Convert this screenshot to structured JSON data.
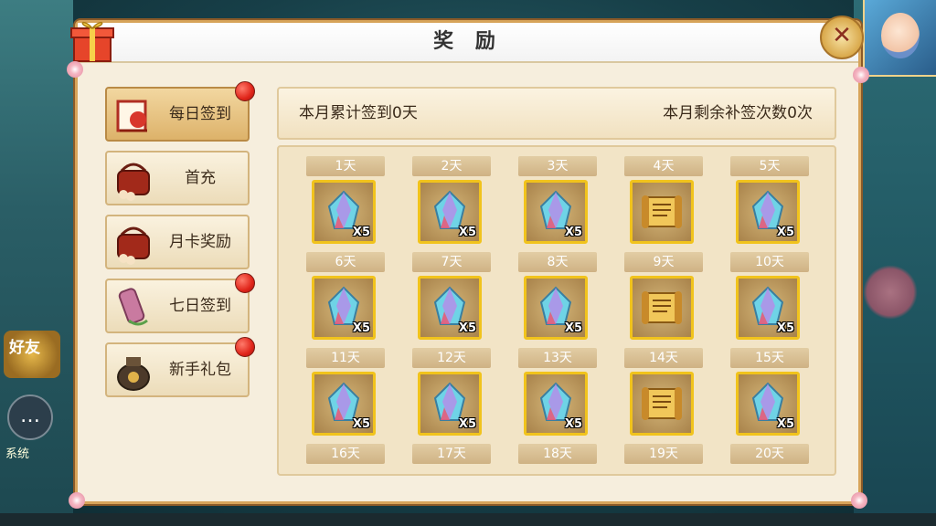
{
  "dialog": {
    "title": "奖 励",
    "close_icon": "close-icon",
    "gift_icon": "gift-box-icon"
  },
  "menu": [
    {
      "label": "每日签到",
      "icon": "sign-in-scroll-icon",
      "active": true,
      "badge": true
    },
    {
      "label": "首充",
      "icon": "basket-icon",
      "active": false,
      "badge": false
    },
    {
      "label": "月卡奖励",
      "icon": "basket-icon",
      "active": false,
      "badge": false
    },
    {
      "label": "七日签到",
      "icon": "scroll-icon",
      "active": false,
      "badge": true
    },
    {
      "label": "新手礼包",
      "icon": "treasure-jar-icon",
      "active": false,
      "badge": true
    }
  ],
  "info": {
    "total_signed": "本月累计签到0天",
    "remaining_makeup": "本月剩余补签次数0次"
  },
  "rewards": [
    {
      "day": "1天",
      "item": "crystal-icon",
      "qty": "X5"
    },
    {
      "day": "2天",
      "item": "crystal-icon",
      "qty": "X5"
    },
    {
      "day": "3天",
      "item": "crystal-icon",
      "qty": "X5"
    },
    {
      "day": "4天",
      "item": "scroll-icon",
      "qty": ""
    },
    {
      "day": "5天",
      "item": "crystal-icon",
      "qty": "X5"
    },
    {
      "day": "6天",
      "item": "crystal-icon",
      "qty": "X5"
    },
    {
      "day": "7天",
      "item": "crystal-icon",
      "qty": "X5"
    },
    {
      "day": "8天",
      "item": "crystal-icon",
      "qty": "X5"
    },
    {
      "day": "9天",
      "item": "scroll-icon",
      "qty": ""
    },
    {
      "day": "10天",
      "item": "crystal-icon",
      "qty": "X5"
    },
    {
      "day": "11天",
      "item": "crystal-icon",
      "qty": "X5"
    },
    {
      "day": "12天",
      "item": "crystal-icon",
      "qty": "X5"
    },
    {
      "day": "13天",
      "item": "crystal-icon",
      "qty": "X5"
    },
    {
      "day": "14天",
      "item": "scroll-icon",
      "qty": ""
    },
    {
      "day": "15天",
      "item": "crystal-icon",
      "qty": "X5"
    },
    {
      "day": "16天",
      "item": "",
      "qty": ""
    },
    {
      "day": "17天",
      "item": "",
      "qty": ""
    },
    {
      "day": "18天",
      "item": "",
      "qty": ""
    },
    {
      "day": "19天",
      "item": "",
      "qty": ""
    },
    {
      "day": "20天",
      "item": "",
      "qty": ""
    }
  ],
  "background": {
    "friend_label": "好友",
    "system_label": "系统"
  },
  "colors": {
    "accent_gold": "#f1c31c",
    "badge_red": "#e0251a",
    "panel_bg": "#f6eedd"
  }
}
